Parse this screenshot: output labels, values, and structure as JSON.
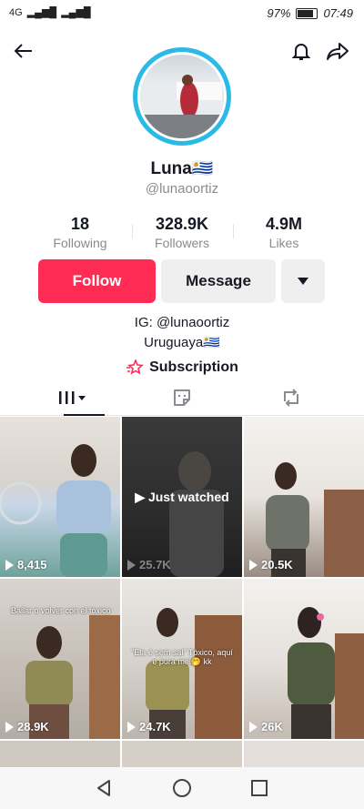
{
  "statusbar": {
    "left": "4G",
    "battery": "97%",
    "time": "07:49"
  },
  "profile": {
    "name": "Luna🇺🇾",
    "handle": "@lunaoortiz"
  },
  "stats": [
    {
      "value": "18",
      "label": "Following"
    },
    {
      "value": "328.9K",
      "label": "Followers"
    },
    {
      "value": "4.9M",
      "label": "Likes"
    }
  ],
  "actions": {
    "follow": "Follow",
    "message": "Message"
  },
  "bio": {
    "line1": "IG: @lunaoortiz",
    "line2": "Uruguaya🇺🇾"
  },
  "subscription": "Subscription",
  "videos": [
    {
      "views": "8,415"
    },
    {
      "views": "25.7K",
      "badge": "Just watched"
    },
    {
      "views": "20.5K"
    },
    {
      "views": "28.9K",
      "caption": "Bailar o volver con el tóxico"
    },
    {
      "views": "24.7K",
      "caption": "\"Ela é sem sal\" Tóxico, aquí e pura mel🤭 kk"
    },
    {
      "views": "26K"
    }
  ],
  "colors": {
    "accent": "#fe2c55",
    "ring": "#2bb9e6"
  }
}
